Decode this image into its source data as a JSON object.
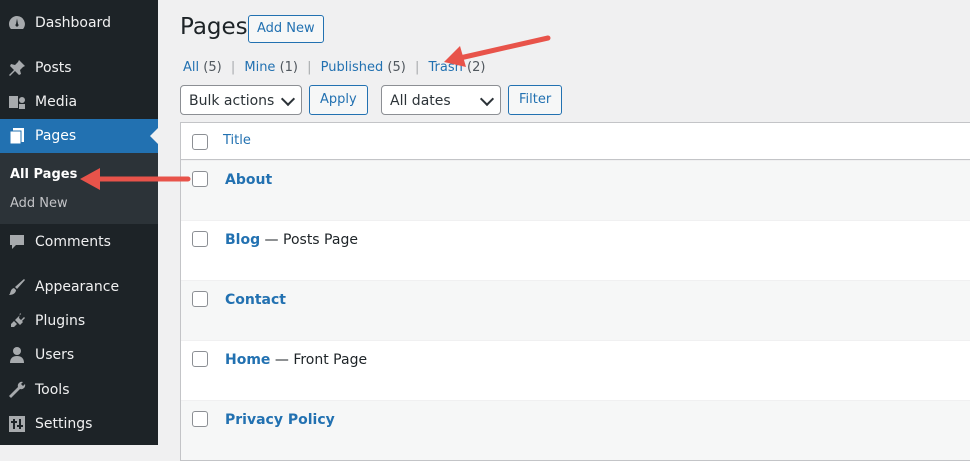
{
  "sidebar": {
    "items": [
      {
        "label": "Dashboard",
        "icon": "dashboard-icon"
      },
      {
        "label": "Posts",
        "icon": "pin-icon"
      },
      {
        "label": "Media",
        "icon": "media-icon"
      },
      {
        "label": "Pages",
        "icon": "pages-icon"
      },
      {
        "label": "Comments",
        "icon": "comment-icon"
      },
      {
        "label": "Appearance",
        "icon": "brush-icon"
      },
      {
        "label": "Plugins",
        "icon": "plugin-icon"
      },
      {
        "label": "Users",
        "icon": "user-icon"
      },
      {
        "label": "Tools",
        "icon": "wrench-icon"
      },
      {
        "label": "Settings",
        "icon": "settings-icon"
      }
    ],
    "submenu": [
      {
        "label": "All Pages"
      },
      {
        "label": "Add New"
      }
    ]
  },
  "header": {
    "title": "Pages",
    "add_new": "Add New"
  },
  "filters": {
    "all": "All",
    "all_count": "(5)",
    "mine": "Mine",
    "mine_count": "(1)",
    "published": "Published",
    "published_count": "(5)",
    "trash": "Trash",
    "trash_count": "(2)",
    "sep": "|"
  },
  "toolbar": {
    "bulk_actions": "Bulk actions",
    "apply": "Apply",
    "all_dates": "All dates",
    "filter": "Filter"
  },
  "table": {
    "column_title": "Title",
    "rows": [
      {
        "title": "About",
        "state": ""
      },
      {
        "title": "Blog",
        "state": " — Posts Page"
      },
      {
        "title": "Contact",
        "state": ""
      },
      {
        "title": "Home",
        "state": " — Front Page"
      },
      {
        "title": "Privacy Policy",
        "state": ""
      }
    ]
  },
  "colors": {
    "accent": "#2271b1",
    "sidebar": "#1d2327",
    "arrow": "#e8534a"
  }
}
